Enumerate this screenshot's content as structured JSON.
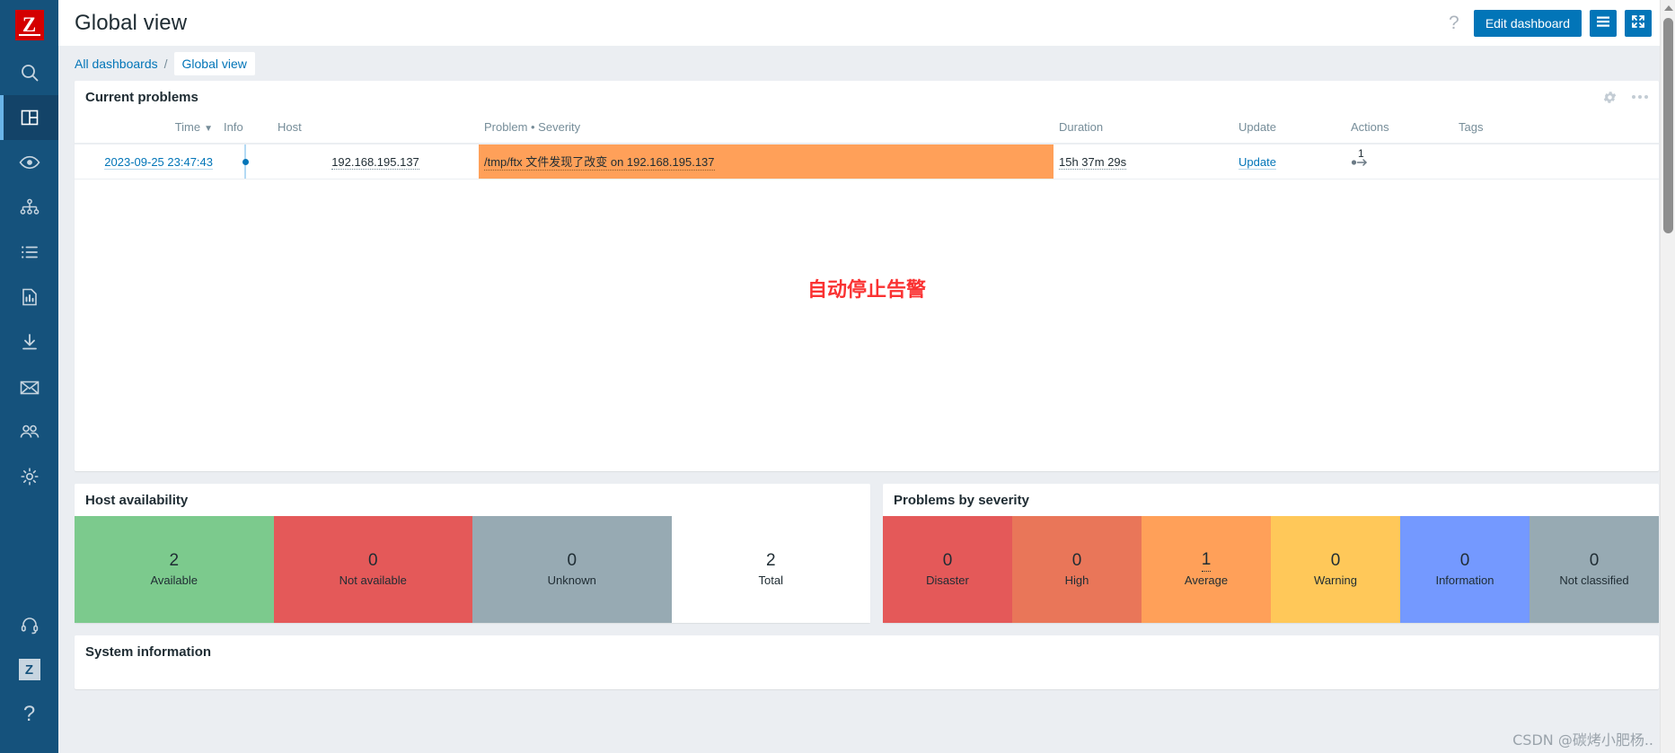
{
  "sidebar": {
    "logo_text": "Z",
    "items": [
      {
        "icon": "search-icon",
        "name": "search"
      },
      {
        "icon": "dashboard-icon",
        "name": "dashboards",
        "active": true
      },
      {
        "icon": "eye-icon",
        "name": "monitoring"
      },
      {
        "icon": "network-tree-icon",
        "name": "services"
      },
      {
        "icon": "list-icon",
        "name": "inventory"
      },
      {
        "icon": "report-chart-icon",
        "name": "reports"
      },
      {
        "icon": "download-icon",
        "name": "data-collection"
      },
      {
        "icon": "mail-icon",
        "name": "alerts"
      },
      {
        "icon": "users-icon",
        "name": "users"
      },
      {
        "icon": "gear-icon",
        "name": "administration"
      }
    ],
    "bottom_items": [
      {
        "icon": "headset-icon",
        "name": "support"
      },
      {
        "icon": "z-badge-icon",
        "name": "zabbix-site",
        "label": "Z"
      },
      {
        "icon": "question-icon",
        "name": "help",
        "label": "?"
      }
    ]
  },
  "header": {
    "title": "Global view",
    "help_label": "?",
    "edit_dashboard_label": "Edit dashboard",
    "menu_icon": "hamburger-icon",
    "kiosk_icon": "fullscreen-icon"
  },
  "breadcrumb": {
    "root_label": "All dashboards",
    "separator": "/",
    "current_label": "Global view"
  },
  "problems_widget": {
    "title": "Current problems",
    "columns": [
      "Time",
      "Info",
      "Host",
      "Problem • Severity",
      "Duration",
      "Update",
      "Actions",
      "Tags"
    ],
    "sort_column": "Time",
    "sort_indicator": "▼",
    "rows": [
      {
        "time": "2023-09-25 23:47:43",
        "info": "",
        "host": "192.168.195.137",
        "problem": "/tmp/ftx 文件发现了改变 on 192.168.195.137",
        "severity": "Average",
        "severity_color": "#ffa059",
        "duration": "15h 37m 29s",
        "update": "Update",
        "actions_count": "1",
        "tags": ""
      }
    ],
    "annotation": "自动停止告警"
  },
  "host_availability_widget": {
    "title": "Host availability",
    "cells": [
      {
        "value": "2",
        "label": "Available",
        "bg": "#7cca8d",
        "fg": "#1f2c33"
      },
      {
        "value": "0",
        "label": "Not available",
        "bg": "#e45959",
        "fg": "#1f2c33"
      },
      {
        "value": "0",
        "label": "Unknown",
        "bg": "#97aab3",
        "fg": "#1f2c33"
      },
      {
        "value": "2",
        "label": "Total",
        "bg": "#ffffff",
        "fg": "#1f2c33"
      }
    ]
  },
  "problems_by_severity_widget": {
    "title": "Problems by severity",
    "cells": [
      {
        "value": "0",
        "label": "Disaster",
        "bg": "#e45959",
        "fg": "#1f2c33",
        "link": false
      },
      {
        "value": "0",
        "label": "High",
        "bg": "#e97659",
        "fg": "#1f2c33",
        "link": false
      },
      {
        "value": "1",
        "label": "Average",
        "bg": "#ffa059",
        "fg": "#1f2c33",
        "link": true
      },
      {
        "value": "0",
        "label": "Warning",
        "bg": "#ffc859",
        "fg": "#1f2c33",
        "link": false
      },
      {
        "value": "0",
        "label": "Information",
        "bg": "#7499ff",
        "fg": "#1f2c33",
        "link": false
      },
      {
        "value": "0",
        "label": "Not classified",
        "bg": "#97aab3",
        "fg": "#1f2c33",
        "link": false
      }
    ]
  },
  "system_information_widget": {
    "title": "System information"
  },
  "watermark": "CSDN @碳烤小肥杨..",
  "colors": {
    "sidebar_bg": "#15527c",
    "accent_blue": "#0275b8",
    "page_bg": "#ebeef2",
    "annotation_red": "#fa3232"
  }
}
